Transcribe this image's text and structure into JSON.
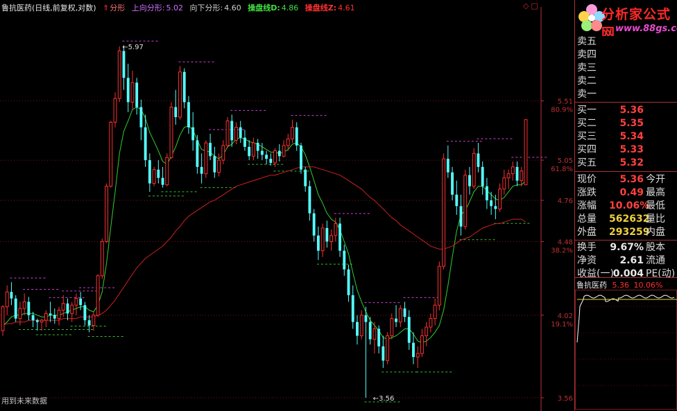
{
  "header": {
    "title": "鲁抗医药(日线,前复权,对数)",
    "fractal_label": "分形",
    "up_fractal_label": "上向分形:",
    "up_fractal_value": "5.02",
    "down_fractal_label": "向下分形:",
    "down_fractal_value": "4.60",
    "line_d_label": "操盘线D:",
    "line_d_value": "4.86",
    "line_z_label": "操盘线Z:",
    "line_z_value": "4.61"
  },
  "footer_note": "用到未来数据",
  "logo": {
    "title": "分析家公式网",
    "url": "www.88gs.com"
  },
  "colors": {
    "up": "#ff3030",
    "down": "#55ffff",
    "line_d": "#30d030",
    "line_z": "#d02020",
    "frac_up": "#d040d0",
    "frac_down": "#30c030",
    "axis": "#c03030"
  },
  "order_book": {
    "sell": [
      {
        "label": "卖五",
        "price": "",
        "vol": ""
      },
      {
        "label": "卖四",
        "price": "",
        "vol": ""
      },
      {
        "label": "卖三",
        "price": "",
        "vol": ""
      },
      {
        "label": "卖二",
        "price": "",
        "vol": ""
      },
      {
        "label": "卖一",
        "price": "",
        "vol": ""
      }
    ],
    "buy": [
      {
        "label": "买一",
        "price": "5.36"
      },
      {
        "label": "买二",
        "price": "5.35"
      },
      {
        "label": "买三",
        "price": "5.34"
      },
      {
        "label": "买四",
        "price": "5.33"
      },
      {
        "label": "买五",
        "price": "5.32"
      }
    ]
  },
  "quote": [
    {
      "label": "现价",
      "value": "5.36",
      "label2": "今开"
    },
    {
      "label": "涨跌",
      "value": "0.49",
      "label2": "最高"
    },
    {
      "label": "涨幅",
      "value": "10.06%",
      "label2": "最低"
    },
    {
      "label": "总量",
      "value": "562632",
      "label2": "量比"
    },
    {
      "label": "外盘",
      "value": "293259",
      "label2": "内盘"
    }
  ],
  "stats": [
    {
      "label": "换手",
      "value": "9.67%",
      "label2": "股本"
    },
    {
      "label": "净资",
      "value": "2.61",
      "label2": "流通"
    },
    {
      "label": "收益(一)",
      "value": "0.004",
      "label2": "PE(动)"
    }
  ],
  "mini_chart": {
    "name": "鲁抗医药",
    "price": "5.36",
    "pct": "10.06%"
  },
  "chart_data": {
    "type": "candlestick",
    "title": "鲁抗医药(日线,前复权,对数)",
    "y_scale": "log",
    "ylim": [
      3.52,
      6.25
    ],
    "price_ticks": [
      5.51,
      5.05,
      4.76,
      4.48,
      4.02,
      3.56
    ],
    "pct_ticks": [
      {
        "price": 5.51,
        "label": "80.9%"
      },
      {
        "price": 5.05,
        "label": "61.8%"
      },
      {
        "price": 4.48,
        "label": "38.2%"
      },
      {
        "price": 4.02,
        "label": "19.1%"
      }
    ],
    "extra_right_label": {
      "price": 5.51,
      "label": "5.51"
    },
    "annotations": [
      {
        "text": "5.97",
        "price": 5.97,
        "bar": 27
      },
      {
        "text": "3.56",
        "price": 3.56,
        "bar": 85
      }
    ],
    "candles": [
      [
        3.93,
        4.08,
        3.9,
        4.07
      ],
      [
        4.07,
        4.2,
        4.02,
        4.16
      ],
      [
        4.16,
        4.22,
        4.08,
        4.12
      ],
      [
        4.12,
        4.14,
        3.98,
        4.0
      ],
      [
        4.0,
        4.1,
        3.96,
        4.06
      ],
      [
        4.06,
        4.15,
        4.02,
        4.1
      ],
      [
        4.1,
        4.13,
        3.99,
        4.02
      ],
      [
        4.02,
        4.04,
        3.95,
        3.99
      ],
      [
        3.99,
        4.0,
        3.93,
        3.98
      ],
      [
        3.98,
        4.0,
        3.93,
        3.99
      ],
      [
        3.99,
        4.05,
        3.95,
        4.03
      ],
      [
        4.03,
        4.1,
        3.98,
        4.02
      ],
      [
        4.02,
        4.06,
        3.97,
        4.0
      ],
      [
        4.0,
        4.07,
        3.96,
        4.05
      ],
      [
        4.05,
        4.14,
        4.01,
        4.09
      ],
      [
        4.09,
        4.12,
        3.99,
        4.03
      ],
      [
        4.03,
        4.1,
        3.98,
        4.08
      ],
      [
        4.08,
        4.15,
        4.02,
        4.12
      ],
      [
        4.12,
        4.16,
        4.05,
        4.08
      ],
      [
        4.08,
        4.1,
        3.96,
        3.99
      ],
      [
        3.99,
        4.02,
        3.92,
        3.96
      ],
      [
        3.96,
        4.04,
        3.93,
        4.02
      ],
      [
        4.02,
        4.27,
        4.01,
        4.26
      ],
      [
        4.26,
        4.5,
        4.24,
        4.48
      ],
      [
        4.48,
        4.88,
        4.47,
        4.86
      ],
      [
        4.86,
        5.35,
        4.85,
        5.34
      ],
      [
        5.34,
        5.58,
        5.3,
        5.53
      ],
      [
        5.53,
        5.97,
        5.5,
        5.93
      ],
      [
        5.93,
        5.98,
        5.6,
        5.7
      ],
      [
        5.7,
        5.82,
        5.42,
        5.5
      ],
      [
        5.5,
        5.76,
        5.44,
        5.66
      ],
      [
        5.66,
        5.7,
        5.4,
        5.46
      ],
      [
        5.46,
        5.52,
        5.2,
        5.3
      ],
      [
        5.3,
        5.4,
        5.0,
        5.05
      ],
      [
        5.05,
        5.1,
        4.82,
        4.88
      ],
      [
        4.88,
        5.0,
        4.86,
        4.98
      ],
      [
        4.98,
        5.05,
        4.88,
        4.92
      ],
      [
        4.92,
        5.0,
        4.85,
        4.87
      ],
      [
        4.87,
        5.1,
        4.86,
        5.07
      ],
      [
        5.07,
        5.5,
        5.06,
        5.46
      ],
      [
        5.46,
        5.6,
        5.32,
        5.38
      ],
      [
        5.38,
        5.8,
        5.36,
        5.75
      ],
      [
        5.75,
        5.78,
        5.45,
        5.5
      ],
      [
        5.5,
        5.55,
        5.25,
        5.3
      ],
      [
        5.3,
        5.42,
        5.12,
        5.2
      ],
      [
        5.2,
        5.24,
        4.95,
        5.0
      ],
      [
        5.0,
        5.1,
        4.88,
        4.95
      ],
      [
        4.95,
        5.2,
        4.92,
        5.18
      ],
      [
        5.18,
        5.25,
        5.05,
        5.08
      ],
      [
        5.08,
        5.15,
        4.92,
        4.96
      ],
      [
        4.96,
        5.1,
        4.93,
        5.05
      ],
      [
        5.05,
        5.2,
        5.02,
        5.16
      ],
      [
        5.16,
        5.38,
        5.14,
        5.35
      ],
      [
        5.35,
        5.4,
        5.15,
        5.2
      ],
      [
        5.2,
        5.34,
        5.17,
        5.3
      ],
      [
        5.3,
        5.35,
        5.18,
        5.22
      ],
      [
        5.22,
        5.28,
        5.12,
        5.15
      ],
      [
        5.15,
        5.2,
        5.05,
        5.08
      ],
      [
        5.08,
        5.22,
        5.05,
        5.18
      ],
      [
        5.18,
        5.21,
        5.06,
        5.12
      ],
      [
        5.12,
        5.18,
        5.05,
        5.09
      ],
      [
        5.09,
        5.12,
        5.02,
        5.06
      ],
      [
        5.06,
        5.1,
        5.01,
        5.03
      ],
      [
        5.03,
        5.14,
        5.0,
        5.12
      ],
      [
        5.12,
        5.17,
        5.04,
        5.08
      ],
      [
        5.08,
        5.2,
        5.07,
        5.16
      ],
      [
        5.16,
        5.25,
        5.12,
        5.21
      ],
      [
        5.21,
        5.36,
        5.18,
        5.3
      ],
      [
        5.3,
        5.34,
        5.12,
        5.16
      ],
      [
        5.16,
        5.18,
        4.95,
        4.98
      ],
      [
        4.98,
        5.0,
        4.82,
        4.86
      ],
      [
        4.86,
        4.9,
        4.62,
        4.67
      ],
      [
        4.67,
        4.7,
        4.48,
        4.52
      ],
      [
        4.52,
        4.58,
        4.36,
        4.42
      ],
      [
        4.42,
        4.6,
        4.38,
        4.57
      ],
      [
        4.57,
        4.62,
        4.44,
        4.48
      ],
      [
        4.48,
        4.56,
        4.42,
        4.52
      ],
      [
        4.52,
        4.64,
        4.48,
        4.6
      ],
      [
        4.6,
        4.64,
        4.38,
        4.42
      ],
      [
        4.42,
        4.46,
        4.26,
        4.3
      ],
      [
        4.3,
        4.33,
        4.1,
        4.14
      ],
      [
        4.14,
        4.2,
        3.94,
        3.98
      ],
      [
        3.98,
        4.02,
        3.85,
        3.9
      ],
      [
        3.9,
        4.05,
        3.88,
        4.02
      ],
      [
        4.02,
        4.07,
        3.56,
        3.98
      ],
      [
        3.98,
        4.01,
        3.85,
        3.88
      ],
      [
        3.88,
        3.98,
        3.8,
        3.94
      ],
      [
        3.94,
        3.96,
        3.8,
        3.84
      ],
      [
        3.84,
        3.9,
        3.72,
        3.76
      ],
      [
        3.76,
        3.92,
        3.74,
        3.9
      ],
      [
        3.9,
        4.03,
        3.88,
        4.0
      ],
      [
        4.0,
        4.08,
        3.95,
        3.98
      ],
      [
        3.98,
        4.08,
        3.95,
        4.06
      ],
      [
        4.06,
        4.1,
        3.98,
        4.01
      ],
      [
        4.01,
        4.05,
        3.82,
        3.86
      ],
      [
        3.86,
        3.92,
        3.74,
        3.78
      ],
      [
        3.78,
        3.84,
        3.72,
        3.8
      ],
      [
        3.8,
        3.94,
        3.78,
        3.9
      ],
      [
        3.9,
        3.98,
        3.84,
        3.95
      ],
      [
        3.95,
        4.03,
        3.92,
        4.0
      ],
      [
        4.0,
        4.12,
        3.96,
        4.08
      ],
      [
        4.08,
        4.35,
        4.05,
        4.32
      ],
      [
        4.32,
        5.1,
        4.3,
        5.06
      ],
      [
        5.06,
        5.16,
        4.92,
        4.96
      ],
      [
        4.96,
        5.0,
        4.76,
        4.8
      ],
      [
        4.8,
        4.9,
        4.66,
        4.72
      ],
      [
        4.72,
        4.8,
        4.52,
        4.58
      ],
      [
        4.58,
        4.98,
        4.56,
        4.94
      ],
      [
        4.94,
        5.0,
        4.8,
        4.86
      ],
      [
        4.86,
        5.14,
        4.84,
        5.1
      ],
      [
        5.1,
        5.18,
        4.96,
        5.0
      ],
      [
        5.0,
        5.04,
        4.8,
        4.86
      ],
      [
        4.86,
        4.92,
        4.7,
        4.76
      ],
      [
        4.76,
        4.82,
        4.66,
        4.72
      ],
      [
        4.72,
        4.8,
        4.63,
        4.7
      ],
      [
        4.7,
        4.88,
        4.68,
        4.84
      ],
      [
        4.84,
        4.98,
        4.8,
        4.92
      ],
      [
        4.92,
        4.98,
        4.84,
        4.95
      ],
      [
        4.95,
        5.04,
        4.9,
        5.0
      ],
      [
        5.0,
        5.04,
        4.86,
        4.9
      ],
      [
        4.9,
        5.0,
        4.86,
        4.97
      ],
      [
        4.87,
        5.36,
        4.87,
        5.36
      ]
    ],
    "series": [
      {
        "name": "操盘线D",
        "values": [
          3.96,
          3.98,
          4.01,
          4.02,
          4.02,
          4.03,
          4.03,
          4.03,
          4.02,
          4.01,
          4.01,
          4.02,
          4.02,
          4.02,
          4.03,
          4.04,
          4.05,
          4.06,
          4.07,
          4.07,
          4.05,
          4.04,
          4.08,
          4.16,
          4.34,
          4.58,
          4.82,
          5.1,
          5.27,
          5.35,
          5.44,
          5.46,
          5.44,
          5.37,
          5.26,
          5.19,
          5.12,
          5.04,
          5.02,
          5.08,
          5.15,
          5.24,
          5.3,
          5.31,
          5.28,
          5.2,
          5.13,
          5.12,
          5.11,
          5.08,
          5.06,
          5.09,
          5.15,
          5.17,
          5.21,
          5.22,
          5.21,
          5.19,
          5.18,
          5.17,
          5.15,
          5.13,
          5.11,
          5.11,
          5.1,
          5.11,
          5.13,
          5.17,
          5.18,
          5.15,
          5.09,
          5.0,
          4.9,
          4.8,
          4.74,
          4.67,
          4.63,
          4.61,
          4.56,
          4.48,
          4.4,
          4.28,
          4.17,
          4.1,
          4.04,
          3.99,
          3.96,
          3.93,
          3.89,
          3.88,
          3.89,
          3.9,
          3.92,
          3.94,
          3.94,
          3.91,
          3.87,
          3.86,
          3.87,
          3.89,
          3.92,
          3.96,
          4.05,
          4.2,
          4.38,
          4.55,
          4.66,
          4.69,
          4.75,
          4.82,
          4.86,
          4.86,
          4.83,
          4.8,
          4.77,
          4.76,
          4.78,
          4.82,
          4.86,
          4.87,
          4.87,
          4.9
        ]
      },
      {
        "name": "操盘线Z",
        "values": [
          3.96,
          3.97,
          3.97,
          3.98,
          3.98,
          3.98,
          3.99,
          3.99,
          3.99,
          3.99,
          3.99,
          3.99,
          3.99,
          3.99,
          4.0,
          4.0,
          4.0,
          4.0,
          4.01,
          4.01,
          4.01,
          4.01,
          4.02,
          4.03,
          4.05,
          4.08,
          4.11,
          4.15,
          4.19,
          4.23,
          4.27,
          4.31,
          4.34,
          4.37,
          4.39,
          4.41,
          4.43,
          4.45,
          4.48,
          4.51,
          4.55,
          4.58,
          4.62,
          4.65,
          4.67,
          4.69,
          4.71,
          4.73,
          4.75,
          4.76,
          4.78,
          4.8,
          4.82,
          4.84,
          4.86,
          4.87,
          4.88,
          4.89,
          4.9,
          4.91,
          4.92,
          4.93,
          4.94,
          4.94,
          4.95,
          4.96,
          4.97,
          4.98,
          4.99,
          5.0,
          5.0,
          5.0,
          5.0,
          4.99,
          4.98,
          4.97,
          4.96,
          4.95,
          4.94,
          4.92,
          4.9,
          4.88,
          4.86,
          4.84,
          4.81,
          4.78,
          4.76,
          4.73,
          4.7,
          4.67,
          4.64,
          4.62,
          4.59,
          4.57,
          4.55,
          4.53,
          4.51,
          4.49,
          4.47,
          4.45,
          4.44,
          4.43,
          4.43,
          4.44,
          4.45,
          4.47,
          4.49,
          4.5,
          4.51,
          4.53,
          4.55,
          4.57,
          4.58,
          4.59,
          4.6,
          4.6,
          4.61,
          4.62,
          4.63,
          4.63,
          4.63,
          4.61
        ]
      }
    ]
  }
}
